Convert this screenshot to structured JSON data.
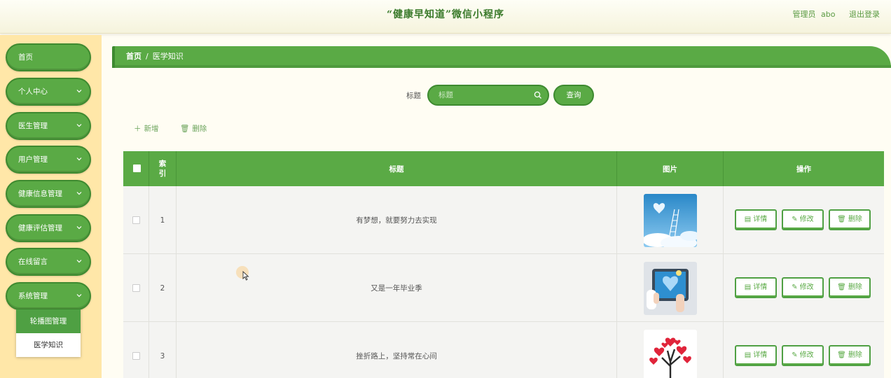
{
  "header": {
    "title": "“健康早知道”微信小程序",
    "role": "管理员",
    "username": "abo",
    "logout": "退出登录"
  },
  "sidebar": {
    "items": [
      {
        "label": "首页",
        "has_submenu": false
      },
      {
        "label": "个人中心",
        "has_submenu": true
      },
      {
        "label": "医生管理",
        "has_submenu": true
      },
      {
        "label": "用户管理",
        "has_submenu": true
      },
      {
        "label": "健康信息管理",
        "has_submenu": true
      },
      {
        "label": "健康评估管理",
        "has_submenu": true
      },
      {
        "label": "在线留言",
        "has_submenu": true
      },
      {
        "label": "系统管理",
        "has_submenu": true
      }
    ],
    "submenu": [
      {
        "label": "轮播图管理",
        "active": true
      },
      {
        "label": "医学知识",
        "active": false
      }
    ]
  },
  "breadcrumb": {
    "home": "首页",
    "separator": "/",
    "current": "医学知识"
  },
  "search": {
    "label": "标题",
    "placeholder": "标题",
    "button": "查询"
  },
  "actions": {
    "add": "新增",
    "delete": "删除"
  },
  "table": {
    "columns": [
      "索引",
      "标题",
      "图片",
      "操作"
    ],
    "rows": [
      {
        "index": "1",
        "title": "有梦想，就要努力去实现",
        "image": "ladder-to-sky"
      },
      {
        "index": "2",
        "title": "又是一年毕业季",
        "image": "tablet-heart"
      },
      {
        "index": "3",
        "title": "挫折路上，坚持常在心间",
        "image": "heart-tree"
      }
    ],
    "row_buttons": {
      "detail": "详情",
      "edit": "修改",
      "delete": "删除"
    }
  },
  "colors": {
    "primary": "#5aaa45",
    "primary_dark": "#3e8a30",
    "sidebar_bg": "#ffe7a8"
  }
}
